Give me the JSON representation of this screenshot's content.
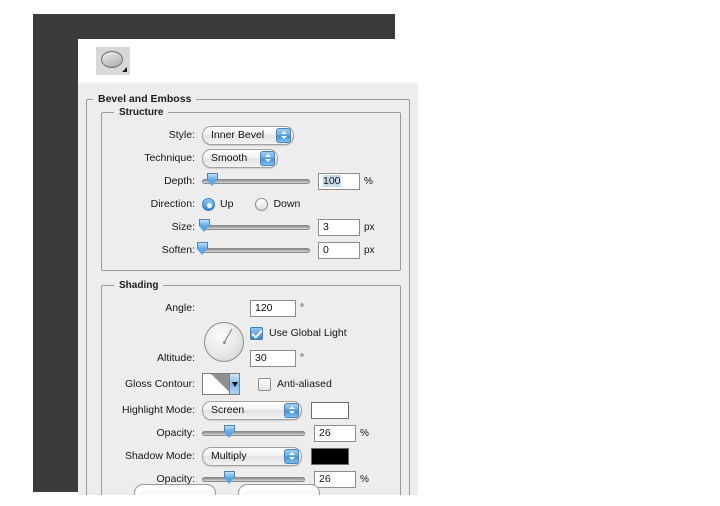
{
  "window": {
    "thumbnail_icon": "layer-style-preview-ellipse",
    "corner_marker_icon": "resize-corner-icon"
  },
  "groups": {
    "bevel_and_emboss": {
      "title": "Bevel and Emboss",
      "structure": {
        "title": "Structure",
        "style": {
          "label": "Style:",
          "value": "Inner Bevel"
        },
        "technique": {
          "label": "Technique:",
          "value": "Smooth"
        },
        "depth": {
          "label": "Depth:",
          "value": "100",
          "unit": "%",
          "slider_percent": 9
        },
        "direction": {
          "label": "Direction:",
          "options": [
            {
              "label": "Up",
              "selected": true
            },
            {
              "label": "Down",
              "selected": false
            }
          ]
        },
        "size": {
          "label": "Size:",
          "value": "3",
          "unit": "px",
          "slider_percent": 2
        },
        "soften": {
          "label": "Soften:",
          "value": "0",
          "unit": "px",
          "slider_percent": 0
        }
      },
      "shading": {
        "title": "Shading",
        "angle": {
          "label": "Angle:",
          "value": "120",
          "unit": "°"
        },
        "use_global_light": {
          "label": "Use Global Light",
          "checked": true
        },
        "altitude": {
          "label": "Altitude:",
          "value": "30",
          "unit": "°"
        },
        "gloss_contour": {
          "label": "Gloss Contour:",
          "icon": "gloss-contour-swatch"
        },
        "anti_aliased": {
          "label": "Anti-aliased",
          "checked": false
        },
        "highlight_mode": {
          "label": "Highlight Mode:",
          "value": "Screen",
          "color": "#ffffff"
        },
        "highlight_opacity": {
          "label": "Opacity:",
          "value": "26",
          "unit": "%",
          "slider_percent": 26
        },
        "shadow_mode": {
          "label": "Shadow Mode:",
          "value": "Multiply",
          "color": "#000000"
        },
        "shadow_opacity": {
          "label": "Opacity:",
          "value": "26",
          "unit": "%",
          "slider_percent": 26
        }
      }
    }
  },
  "colors": {
    "chrome": "#3c3a3b",
    "pane": "#ededed",
    "accent": "#3b87d4"
  }
}
